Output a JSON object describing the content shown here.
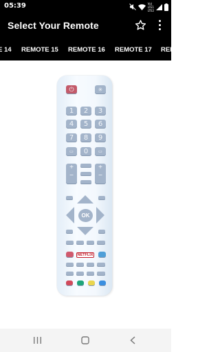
{
  "status_bar": {
    "time": "05:39",
    "network_line1": "Vo)",
    "network_line2": "LTE1",
    "network_line3": "LTE2"
  },
  "app_bar": {
    "title": "Select Your Remote",
    "favorite_icon": "star-outline-icon",
    "more_icon": "more-vertical-icon"
  },
  "tabs": [
    "E 14",
    "REMOTE 15",
    "REMOTE 16",
    "REMOTE 17",
    "REM"
  ],
  "remote": {
    "digits": [
      "1",
      "2",
      "3",
      "4",
      "5",
      "6",
      "7",
      "8",
      "9",
      "0"
    ],
    "ok_label": "OK",
    "netflix_label": "NETFLIX",
    "color_keys": [
      "#d1495b",
      "#1ea57a",
      "#ead64e",
      "#3a8fe0"
    ]
  },
  "nav_bar": {
    "recents_icon": "recents-icon",
    "home_icon": "home-icon",
    "back_icon": "back-icon"
  }
}
